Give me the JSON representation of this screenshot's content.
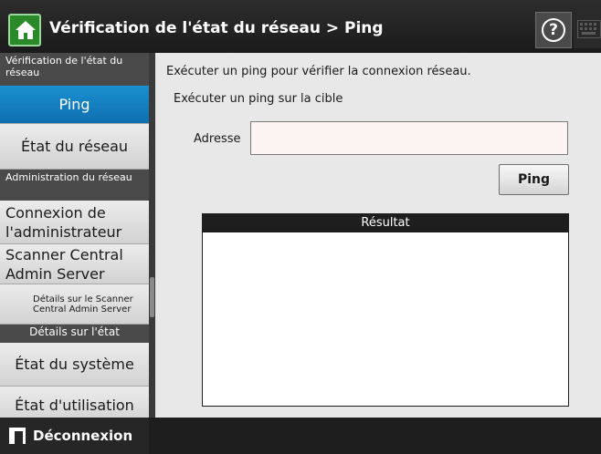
{
  "header": {
    "title": "Vérification de l'état du réseau > Ping",
    "help_glyph": "?"
  },
  "sidebar": {
    "section1_title": "Vérification de l'état du réseau",
    "ping": "Ping",
    "network_status": "État du réseau",
    "section2_title": "Administration du réseau",
    "admin_connection": "Connexion de l'administrateur",
    "scanner_central": "Scanner Central Admin Server",
    "scanner_central_details": "Détails sur le Scanner Central Admin Server",
    "section3_title": "Détails sur l'état",
    "system_status": "État du système",
    "usage_status": "État d'utilisation"
  },
  "main": {
    "description": "Exécuter un ping pour vérifier la connexion réseau.",
    "subtitle": "Exécuter un ping sur la cible",
    "address_label": "Adresse",
    "address_value": "",
    "ping_button": "Ping",
    "result_header": "Résultat",
    "result_text": ""
  },
  "footer": {
    "logout": "Déconnexion"
  },
  "colors": {
    "header_bg": "#1b1b1b",
    "sidebar_active": "#1583c4",
    "home_green": "#2a8a2a",
    "input_bg": "#fcf3f3"
  },
  "icons": {
    "home": "home-icon",
    "help": "help-icon",
    "keyboard": "keyboard-icon",
    "logout": "logout-icon"
  }
}
